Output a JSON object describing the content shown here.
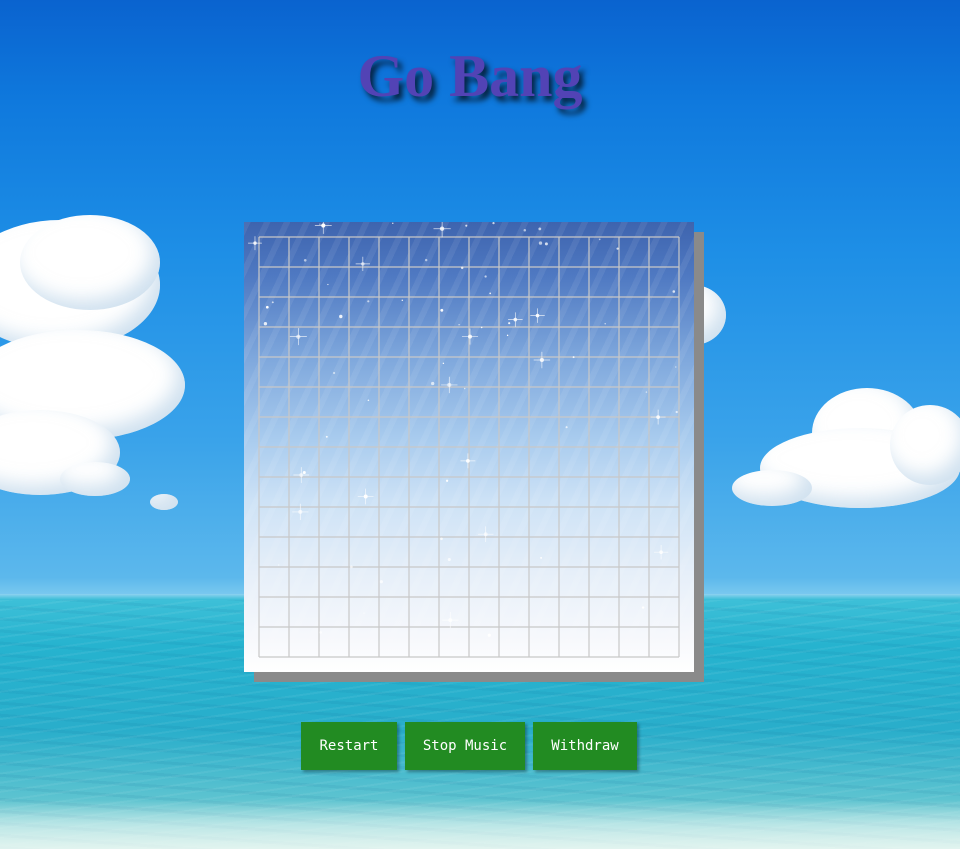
{
  "title": "Go Bang",
  "board": {
    "grid_lines": 15,
    "line_color": "#c8c8c8"
  },
  "buttons": {
    "restart": "Restart",
    "stop_music": "Stop Music",
    "withdraw": "Withdraw"
  },
  "colors": {
    "button_bg": "#228b22",
    "title": "#5243b5"
  }
}
